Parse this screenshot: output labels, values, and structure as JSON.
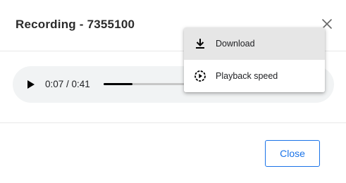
{
  "dialog": {
    "title": "Recording - 7355100",
    "close_icon": "close-icon"
  },
  "player": {
    "play_icon": "play-icon",
    "time": "0:07 / 0:41",
    "progress_fraction": 0.17
  },
  "menu": {
    "items": [
      {
        "label": "Download",
        "icon": "download-icon",
        "highlighted": true
      },
      {
        "label": "Playback speed",
        "icon": "playback-speed-icon",
        "highlighted": false
      }
    ]
  },
  "footer": {
    "close_label": "Close"
  },
  "colors": {
    "accent": "#1a73e8",
    "player_bg": "#f1f3f4",
    "menu_highlight": "#e6e6e6"
  }
}
